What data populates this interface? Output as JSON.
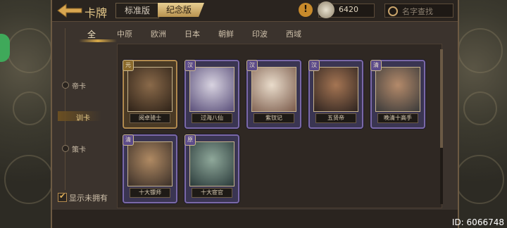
{
  "header": {
    "title": "卡牌",
    "version_standard": "标准版",
    "version_memorial": "纪念版",
    "warning_icon": "warning-icon",
    "currency_value": "6420",
    "search_placeholder": "名字查找"
  },
  "tabs": [
    {
      "label": "全",
      "active": true
    },
    {
      "label": "中原"
    },
    {
      "label": "欧洲"
    },
    {
      "label": "日本"
    },
    {
      "label": "朝鲜"
    },
    {
      "label": "印波"
    },
    {
      "label": "西域"
    }
  ],
  "categories": [
    {
      "label": "帝卡"
    },
    {
      "label": "训卡",
      "active": true
    },
    {
      "label": "策卡"
    }
  ],
  "cards": [
    {
      "badge": "元",
      "name": "阅卓骑士",
      "style": "gold"
    },
    {
      "badge": "汉",
      "name": "过海八仙",
      "style": "purple"
    },
    {
      "badge": "汉",
      "name": "紫钗记",
      "style": "purple"
    },
    {
      "badge": "汉",
      "name": "五贤帝",
      "style": "purple"
    },
    {
      "badge": "清",
      "name": "晚清十高手",
      "style": "purple"
    },
    {
      "badge": "清",
      "name": "十大镖师",
      "style": "purple"
    },
    {
      "badge": "原",
      "name": "十大宦官",
      "style": "purple"
    }
  ],
  "show_unowned_label": "显示未拥有",
  "footer": {
    "id_text": "ID: 6066748"
  }
}
